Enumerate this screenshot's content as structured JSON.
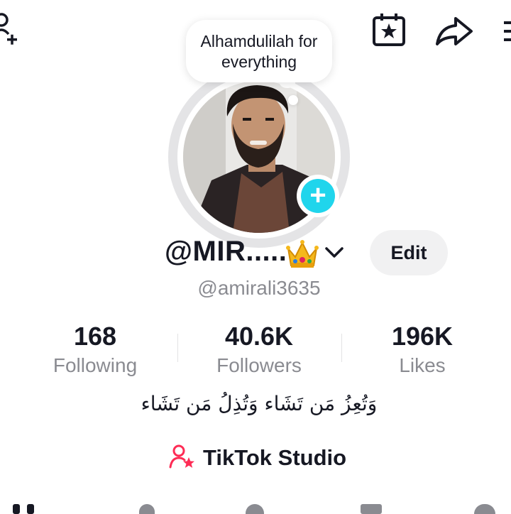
{
  "note": {
    "text": "Alhamdulilah for everything"
  },
  "profile": {
    "display_name": "@MIR.....",
    "crown_emoji": "👑",
    "username": "@amirali3635",
    "edit_label": "Edit",
    "bio": "وَتُعِزُ مَن تَشَاء وَتُذِلُ مَن تَشَاء"
  },
  "stats": [
    {
      "value": "168",
      "label": "Following"
    },
    {
      "value": "40.6K",
      "label": "Followers"
    },
    {
      "value": "196K",
      "label": "Likes"
    }
  ],
  "studio": {
    "label": "TikTok Studio",
    "icon": "person-star-icon"
  },
  "icons": {
    "top_left": "add-friend-icon",
    "top_right": [
      "calendar-star-icon",
      "share-arrow-icon",
      "menu-icon"
    ]
  },
  "colors": {
    "accent_cyan": "#20d5ec",
    "brand_pink": "#fe2c55",
    "muted_text": "#8a8b91"
  }
}
